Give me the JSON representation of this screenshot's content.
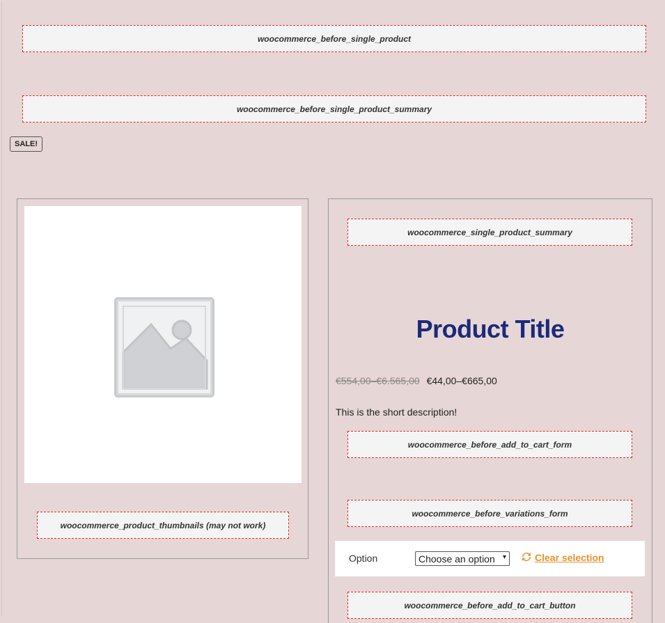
{
  "hooks": {
    "before_single_product": "woocommerce_before_single_product",
    "before_single_product_summary": "woocommerce_before_single_product_summary",
    "single_product_summary": "woocommerce_single_product_summary",
    "product_thumbnails": "woocommerce_product_thumbnails (may not work)",
    "before_add_to_cart_form": "woocommerce_before_add_to_cart_form",
    "before_variations_form": "woocommerce_before_variations_form",
    "before_add_to_cart_button": "woocommerce_before_add_to_cart_button"
  },
  "badge": {
    "sale": "SALE!"
  },
  "product": {
    "title": "Product Title",
    "price_old": "€554,00–€6.565,00",
    "price_new": "€44,00–€665,00",
    "short_description": "This is the short description!",
    "image_icon": "image-placeholder-icon"
  },
  "variations": {
    "label": "Option",
    "select_value": "Choose an option",
    "clear_label": "Clear selection",
    "clear_icon": "refresh-icon"
  },
  "colors": {
    "background": "#e6d6d6",
    "hook_border": "#e02424",
    "title": "#1b2a7a",
    "accent": "#e8912a"
  }
}
